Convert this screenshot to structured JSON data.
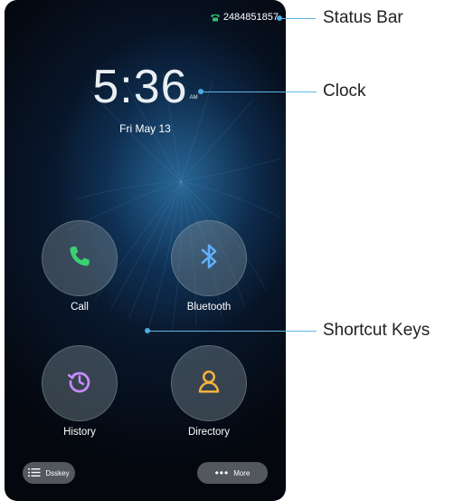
{
  "status_bar": {
    "phone_number": "2484851857",
    "icon": "phone-icon",
    "icon_color": "#2fbf71"
  },
  "clock": {
    "time": "5:36",
    "ampm": "AM",
    "date": "Fri May 13"
  },
  "shortcuts": [
    {
      "label": "Call",
      "icon": "phone-icon",
      "icon_color": "#3ad173"
    },
    {
      "label": "Bluetooth",
      "icon": "bluetooth-icon",
      "icon_color": "#5fb0ff"
    },
    {
      "label": "History",
      "icon": "history-icon",
      "icon_color": "#c78bff"
    },
    {
      "label": "Directory",
      "icon": "contact-icon",
      "icon_color": "#f3b23c"
    }
  ],
  "bottom_bar": {
    "dsskey_label": "Dsskey",
    "more_label": "More"
  },
  "callouts": {
    "status_bar": "Status Bar",
    "clock": "Clock",
    "shortcut_keys": "Shortcut Keys"
  },
  "colors": {
    "callout_line": "#5fb7e6",
    "callout_dot": "#4aa9df"
  }
}
